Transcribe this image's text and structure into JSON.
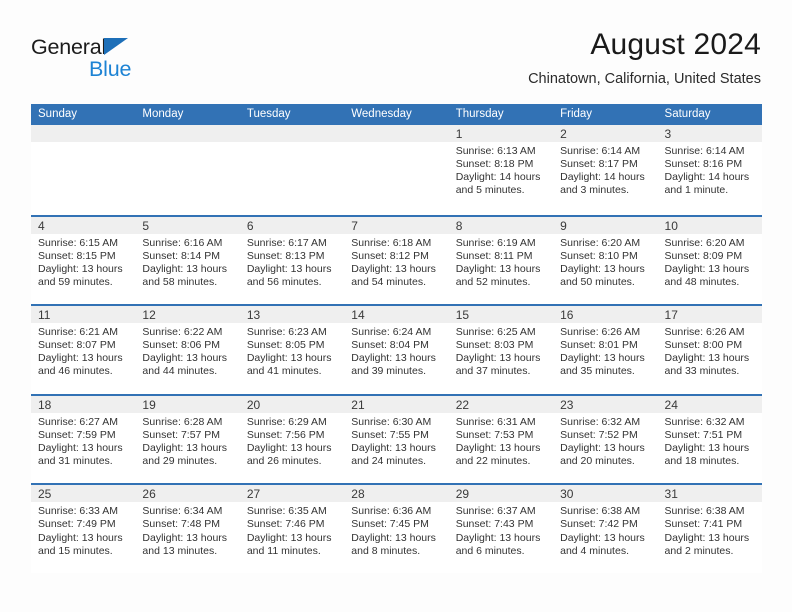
{
  "brand": {
    "name_part1": "General",
    "name_part2": "Blue",
    "triangle_icon": "triangle-icon",
    "color_dark": "#1c1c1c",
    "color_blue": "#1d83d4"
  },
  "header": {
    "month_title": "August 2024",
    "location": "Chinatown, California, United States"
  },
  "theme": {
    "header_blue": "#3272b5",
    "daystrip_gray": "#efefef",
    "cell_white": "#ffffff",
    "text": "#333333"
  },
  "calendar": {
    "weekdays": [
      "Sunday",
      "Monday",
      "Tuesday",
      "Wednesday",
      "Thursday",
      "Friday",
      "Saturday"
    ],
    "weeks": [
      [
        {
          "day": "",
          "lines": []
        },
        {
          "day": "",
          "lines": []
        },
        {
          "day": "",
          "lines": []
        },
        {
          "day": "",
          "lines": []
        },
        {
          "day": "1",
          "lines": [
            "Sunrise: 6:13 AM",
            "Sunset: 8:18 PM",
            "Daylight: 14 hours",
            "and 5 minutes."
          ]
        },
        {
          "day": "2",
          "lines": [
            "Sunrise: 6:14 AM",
            "Sunset: 8:17 PM",
            "Daylight: 14 hours",
            "and 3 minutes."
          ]
        },
        {
          "day": "3",
          "lines": [
            "Sunrise: 6:14 AM",
            "Sunset: 8:16 PM",
            "Daylight: 14 hours",
            "and 1 minute."
          ]
        }
      ],
      [
        {
          "day": "4",
          "lines": [
            "Sunrise: 6:15 AM",
            "Sunset: 8:15 PM",
            "Daylight: 13 hours",
            "and 59 minutes."
          ]
        },
        {
          "day": "5",
          "lines": [
            "Sunrise: 6:16 AM",
            "Sunset: 8:14 PM",
            "Daylight: 13 hours",
            "and 58 minutes."
          ]
        },
        {
          "day": "6",
          "lines": [
            "Sunrise: 6:17 AM",
            "Sunset: 8:13 PM",
            "Daylight: 13 hours",
            "and 56 minutes."
          ]
        },
        {
          "day": "7",
          "lines": [
            "Sunrise: 6:18 AM",
            "Sunset: 8:12 PM",
            "Daylight: 13 hours",
            "and 54 minutes."
          ]
        },
        {
          "day": "8",
          "lines": [
            "Sunrise: 6:19 AM",
            "Sunset: 8:11 PM",
            "Daylight: 13 hours",
            "and 52 minutes."
          ]
        },
        {
          "day": "9",
          "lines": [
            "Sunrise: 6:20 AM",
            "Sunset: 8:10 PM",
            "Daylight: 13 hours",
            "and 50 minutes."
          ]
        },
        {
          "day": "10",
          "lines": [
            "Sunrise: 6:20 AM",
            "Sunset: 8:09 PM",
            "Daylight: 13 hours",
            "and 48 minutes."
          ]
        }
      ],
      [
        {
          "day": "11",
          "lines": [
            "Sunrise: 6:21 AM",
            "Sunset: 8:07 PM",
            "Daylight: 13 hours",
            "and 46 minutes."
          ]
        },
        {
          "day": "12",
          "lines": [
            "Sunrise: 6:22 AM",
            "Sunset: 8:06 PM",
            "Daylight: 13 hours",
            "and 44 minutes."
          ]
        },
        {
          "day": "13",
          "lines": [
            "Sunrise: 6:23 AM",
            "Sunset: 8:05 PM",
            "Daylight: 13 hours",
            "and 41 minutes."
          ]
        },
        {
          "day": "14",
          "lines": [
            "Sunrise: 6:24 AM",
            "Sunset: 8:04 PM",
            "Daylight: 13 hours",
            "and 39 minutes."
          ]
        },
        {
          "day": "15",
          "lines": [
            "Sunrise: 6:25 AM",
            "Sunset: 8:03 PM",
            "Daylight: 13 hours",
            "and 37 minutes."
          ]
        },
        {
          "day": "16",
          "lines": [
            "Sunrise: 6:26 AM",
            "Sunset: 8:01 PM",
            "Daylight: 13 hours",
            "and 35 minutes."
          ]
        },
        {
          "day": "17",
          "lines": [
            "Sunrise: 6:26 AM",
            "Sunset: 8:00 PM",
            "Daylight: 13 hours",
            "and 33 minutes."
          ]
        }
      ],
      [
        {
          "day": "18",
          "lines": [
            "Sunrise: 6:27 AM",
            "Sunset: 7:59 PM",
            "Daylight: 13 hours",
            "and 31 minutes."
          ]
        },
        {
          "day": "19",
          "lines": [
            "Sunrise: 6:28 AM",
            "Sunset: 7:57 PM",
            "Daylight: 13 hours",
            "and 29 minutes."
          ]
        },
        {
          "day": "20",
          "lines": [
            "Sunrise: 6:29 AM",
            "Sunset: 7:56 PM",
            "Daylight: 13 hours",
            "and 26 minutes."
          ]
        },
        {
          "day": "21",
          "lines": [
            "Sunrise: 6:30 AM",
            "Sunset: 7:55 PM",
            "Daylight: 13 hours",
            "and 24 minutes."
          ]
        },
        {
          "day": "22",
          "lines": [
            "Sunrise: 6:31 AM",
            "Sunset: 7:53 PM",
            "Daylight: 13 hours",
            "and 22 minutes."
          ]
        },
        {
          "day": "23",
          "lines": [
            "Sunrise: 6:32 AM",
            "Sunset: 7:52 PM",
            "Daylight: 13 hours",
            "and 20 minutes."
          ]
        },
        {
          "day": "24",
          "lines": [
            "Sunrise: 6:32 AM",
            "Sunset: 7:51 PM",
            "Daylight: 13 hours",
            "and 18 minutes."
          ]
        }
      ],
      [
        {
          "day": "25",
          "lines": [
            "Sunrise: 6:33 AM",
            "Sunset: 7:49 PM",
            "Daylight: 13 hours",
            "and 15 minutes."
          ]
        },
        {
          "day": "26",
          "lines": [
            "Sunrise: 6:34 AM",
            "Sunset: 7:48 PM",
            "Daylight: 13 hours",
            "and 13 minutes."
          ]
        },
        {
          "day": "27",
          "lines": [
            "Sunrise: 6:35 AM",
            "Sunset: 7:46 PM",
            "Daylight: 13 hours",
            "and 11 minutes."
          ]
        },
        {
          "day": "28",
          "lines": [
            "Sunrise: 6:36 AM",
            "Sunset: 7:45 PM",
            "Daylight: 13 hours",
            "and 8 minutes."
          ]
        },
        {
          "day": "29",
          "lines": [
            "Sunrise: 6:37 AM",
            "Sunset: 7:43 PM",
            "Daylight: 13 hours",
            "and 6 minutes."
          ]
        },
        {
          "day": "30",
          "lines": [
            "Sunrise: 6:38 AM",
            "Sunset: 7:42 PM",
            "Daylight: 13 hours",
            "and 4 minutes."
          ]
        },
        {
          "day": "31",
          "lines": [
            "Sunrise: 6:38 AM",
            "Sunset: 7:41 PM",
            "Daylight: 13 hours",
            "and 2 minutes."
          ]
        }
      ]
    ]
  }
}
